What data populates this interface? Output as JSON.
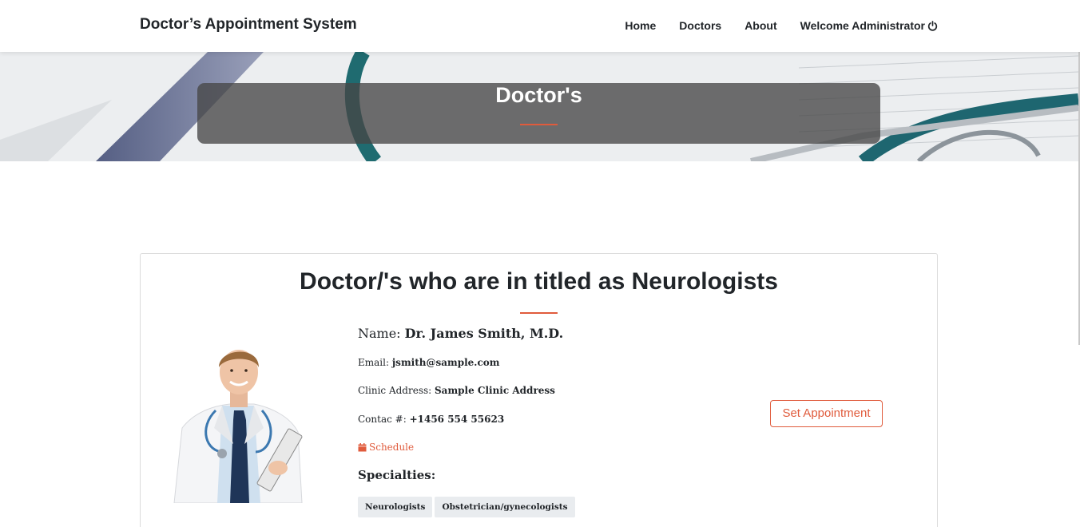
{
  "navbar": {
    "brand": "Doctor’s Appointment System",
    "links": [
      {
        "label": "Home"
      },
      {
        "label": "Doctors"
      },
      {
        "label": "About"
      },
      {
        "label": "Welcome Administrator"
      }
    ],
    "logout_icon": "power-icon"
  },
  "hero": {
    "title": "Doctor's",
    "accent_color": "#e05b3c"
  },
  "card": {
    "title": "Doctor/'s who are in titled as Neurologists",
    "doctor": {
      "name_label": "Name:",
      "name": "Dr. James Smith, M.D.",
      "email_label": "Email:",
      "email": "jsmith@sample.com",
      "address_label": "Clinic Address:",
      "address": "Sample Clinic Address",
      "contact_label": "Contac #:",
      "contact": "+1456 554 55623",
      "schedule_label": "Schedule",
      "schedule_icon": "calendar-icon",
      "specialties_label": "Specialties:",
      "specialties": [
        "Neurologists",
        "Obstetrician/gynecologists"
      ]
    },
    "set_appointment_label": "Set Appointment"
  }
}
